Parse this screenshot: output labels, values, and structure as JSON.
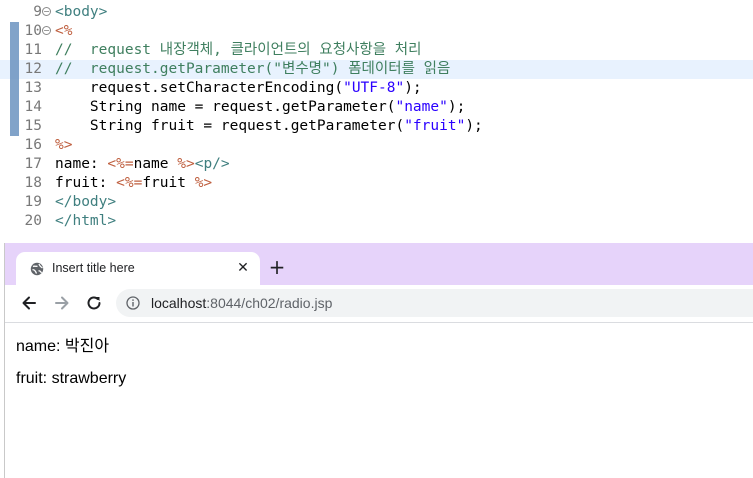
{
  "editor": {
    "lines": [
      {
        "num": "9",
        "fold": "⊖",
        "segments": [
          {
            "cls": "tag",
            "text": "<body>"
          }
        ]
      },
      {
        "num": "10",
        "fold": "⊖",
        "segments": [
          {
            "cls": "scriptlet",
            "text": "<%"
          }
        ]
      },
      {
        "num": "11",
        "fold": "",
        "segments": [
          {
            "cls": "cmt",
            "text": "//  request "
          },
          {
            "cls": "cmt ko",
            "text": "내장객체, 클라이언트의 요청사항을 처리"
          }
        ]
      },
      {
        "num": "12",
        "fold": "",
        "segments": [
          {
            "cls": "cmt",
            "text": "//  request.getParameter(\""
          },
          {
            "cls": "cmt ko",
            "text": "변수명"
          },
          {
            "cls": "cmt",
            "text": "\") "
          },
          {
            "cls": "cmt ko",
            "text": "폼데이터를 읽음"
          }
        ]
      },
      {
        "num": "13",
        "fold": "",
        "segments": [
          {
            "cls": "plain",
            "text": "    request.setCharacterEncoding("
          },
          {
            "cls": "str",
            "text": "\"UTF-8\""
          },
          {
            "cls": "plain",
            "text": ");"
          }
        ]
      },
      {
        "num": "14",
        "fold": "",
        "segments": [
          {
            "cls": "plain",
            "text": "    String name = request.getParameter("
          },
          {
            "cls": "str",
            "text": "\"name\""
          },
          {
            "cls": "plain",
            "text": ");"
          }
        ]
      },
      {
        "num": "15",
        "fold": "",
        "segments": [
          {
            "cls": "plain",
            "text": "    String fruit = request.getParameter("
          },
          {
            "cls": "str",
            "text": "\"fruit\""
          },
          {
            "cls": "plain",
            "text": ");"
          }
        ]
      },
      {
        "num": "16",
        "fold": "",
        "segments": [
          {
            "cls": "scriptlet",
            "text": "%>"
          }
        ]
      },
      {
        "num": "17",
        "fold": "",
        "segments": [
          {
            "cls": "plain",
            "text": "name: "
          },
          {
            "cls": "scriptlet",
            "text": "<%="
          },
          {
            "cls": "plain",
            "text": "name "
          },
          {
            "cls": "scriptlet",
            "text": "%>"
          },
          {
            "cls": "tag",
            "text": "<p/>"
          }
        ]
      },
      {
        "num": "18",
        "fold": "",
        "segments": [
          {
            "cls": "plain",
            "text": "fruit: "
          },
          {
            "cls": "scriptlet",
            "text": "<%="
          },
          {
            "cls": "plain",
            "text": "fruit "
          },
          {
            "cls": "scriptlet",
            "text": "%>"
          }
        ]
      },
      {
        "num": "19",
        "fold": "",
        "segments": [
          {
            "cls": "tag",
            "text": "</body>"
          }
        ]
      },
      {
        "num": "20",
        "fold": "",
        "segments": [
          {
            "cls": "tag",
            "text": "</html>"
          }
        ]
      }
    ]
  },
  "browser": {
    "tab_title": "Insert title here",
    "tab_close_glyph": "✕",
    "new_tab_glyph": "+",
    "tab_favicon": "globe-icon",
    "nav": {
      "back": "arrow-left-icon",
      "forward": "arrow-right-icon",
      "reload": "reload-icon"
    },
    "url_host": "localhost",
    "url_rest": ":8044/ch02/radio.jsp",
    "colors": {
      "tabstrip": "#e6d3fa",
      "omnibox": "#f1f3f4"
    }
  },
  "page": {
    "name_line": "name: 박진아",
    "fruit_line": "fruit: strawberry"
  }
}
